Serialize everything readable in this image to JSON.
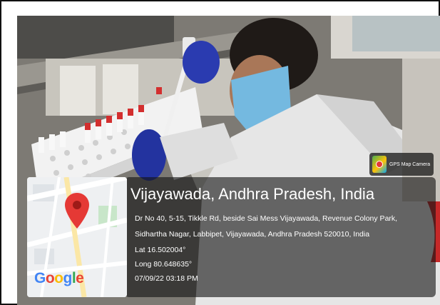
{
  "location": {
    "title": "Vijayawada, Andhra Pradesh, India",
    "address_line1": "Dr No 40, 5-15, Tikkle Rd, beside Sai Mess Vijayawada, Revenue Colony Park,",
    "address_line2": "Sidhartha Nagar, Labbipet, Vijayawada, Andhra Pradesh 520010, India",
    "lat": "Lat 16.502004°",
    "long": "Long 80.648635°",
    "datetime": "07/09/22 03:18 PM"
  },
  "badge": {
    "label": "GPS Map Camera",
    "icon": "gps-map-camera-icon"
  },
  "map": {
    "logo": "Google",
    "pin_icon": "map-pin-icon",
    "pin_color": "#e53935"
  },
  "colors": {
    "overlay": "#141414",
    "glove": "#2336a8",
    "mask": "#6fb6dd",
    "coat": "#e8e8e8"
  }
}
